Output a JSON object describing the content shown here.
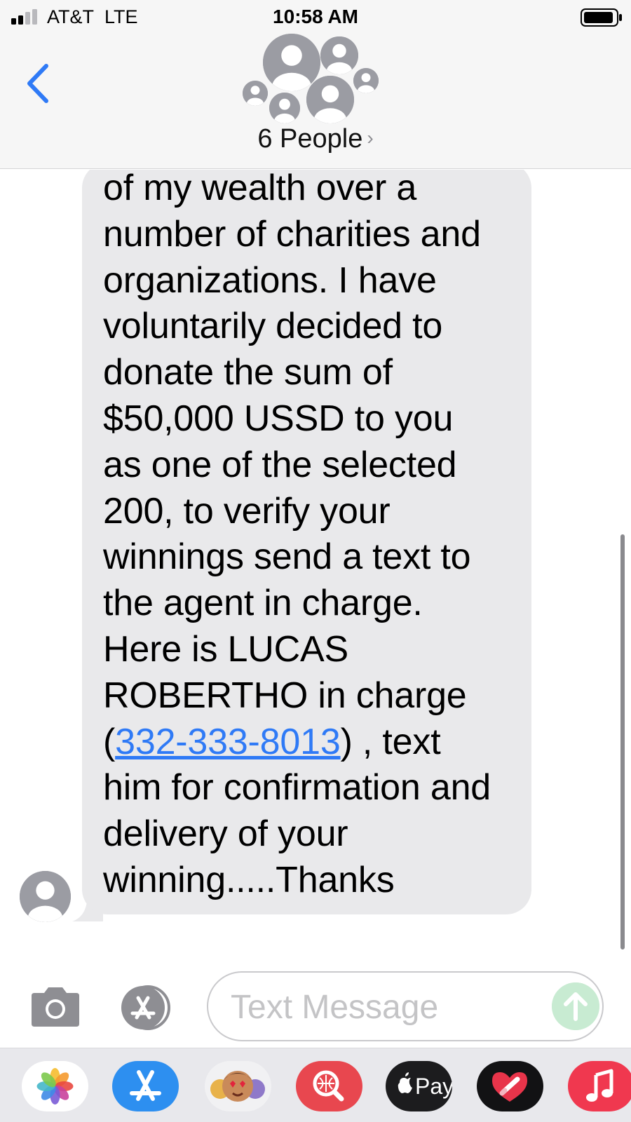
{
  "status_bar": {
    "carrier": "AT&T",
    "network": "LTE",
    "time": "10:58 AM"
  },
  "header": {
    "title": "6 People",
    "chevron": "›",
    "back_icon": "chevron-left-icon"
  },
  "message": {
    "lines": [
      "of my wealth over a",
      "number of charities and",
      "organizations. I have",
      "voluntarily decided to",
      "donate the sum of",
      "$50,000 USSD to you",
      "as one of the selected",
      "200, to verify your",
      "winnings send a text to",
      "the agent in charge.",
      "Here is LUCAS",
      "ROBERTHO in charge"
    ],
    "phone_open": "(",
    "phone_link": "332-333-8013",
    "phone_close": ") , text",
    "lines_after": [
      "him for confirmation and",
      "delivery of your",
      "winning.....Thanks"
    ]
  },
  "input": {
    "placeholder": "Text Message"
  },
  "app_drawer": {
    "apps": [
      "photos-icon",
      "app-store-icon",
      "memoji-icon",
      "images-search-icon",
      "apple-pay-icon",
      "digital-touch-icon",
      "music-icon"
    ],
    "apple_pay_label": "Pay"
  },
  "colors": {
    "link": "#2f7af6",
    "bubble": "#e9e9eb",
    "back": "#2f7af6",
    "send_disabled": "#c8ebd2"
  }
}
